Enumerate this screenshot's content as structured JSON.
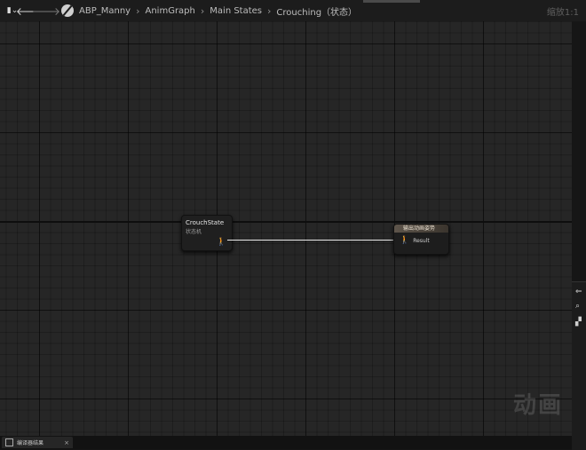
{
  "toolbar": {
    "breadcrumb": [
      "ABP_Manny",
      "AnimGraph",
      "Main States",
      "Crouching（状态）"
    ],
    "zoom_label": "缩放1:1"
  },
  "graph": {
    "crouch_node": {
      "title": "CrouchState",
      "subtitle": "状态机"
    },
    "result_node": {
      "header": "输出动画姿势",
      "pin_label": "Result"
    },
    "watermark": "动画"
  },
  "bottom": {
    "tab_label": "编译器结果",
    "tab_close": "×"
  },
  "icons": {
    "graph": "graph-icon",
    "back": "arrow-left-icon",
    "forward": "arrow-right-icon",
    "blueprint": "blueprint-icon",
    "pose_pin": "pose-pin-icon"
  }
}
